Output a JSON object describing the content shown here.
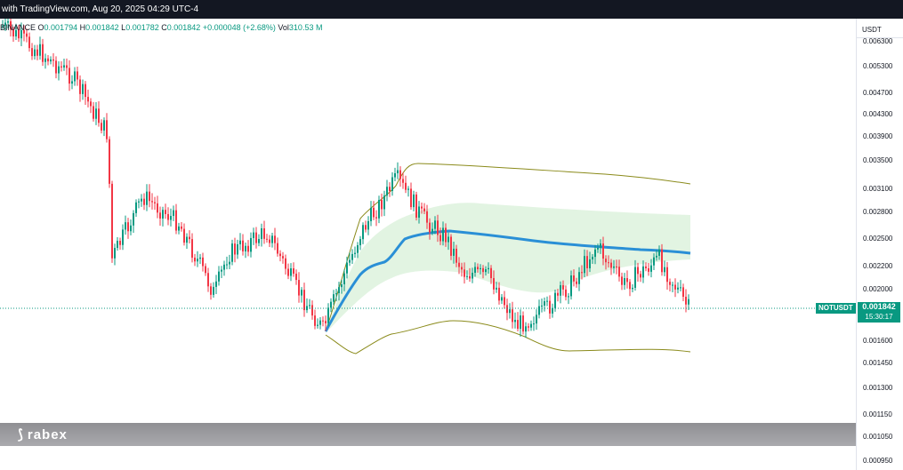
{
  "header": {
    "credit": "with TradingView.com, Aug 20, 2025 04:29 UTC-4"
  },
  "ohlc": {
    "exchange": "BINANCE",
    "open_label": "O",
    "open": "0.001794",
    "high_label": "H",
    "high": "0.001842",
    "low_label": "L",
    "low": "0.001782",
    "close_label": "C",
    "close": "0.001842",
    "change": "+0.000048 (+2.68%)",
    "vol_label": "Vol",
    "vol": "310.53 M"
  },
  "price_axis": {
    "unit": "USDT",
    "ticks": [
      "0.006300",
      "0.005300",
      "0.004700",
      "0.004300",
      "0.003900",
      "0.003500",
      "0.003100",
      "0.002800",
      "0.002500",
      "0.002200",
      "0.002000",
      "0.001600",
      "0.001450",
      "0.001300",
      "0.001150",
      "0.001050",
      "0.000950"
    ]
  },
  "current_price": {
    "symbol": "NOTUSDT",
    "price": "0.001842",
    "countdown": "15:30:17"
  },
  "footer": {
    "logo": "rabex"
  },
  "colors": {
    "up": "#089981",
    "down": "#f23645",
    "ma_line": "#2a8fd6",
    "band": "#8a8a1a",
    "band_fill": "#d8f0d8"
  },
  "chart_data": {
    "type": "candlestick",
    "title": "",
    "y_scale": "log",
    "ylim": [
      0.00095,
      0.0064
    ],
    "current_price": 0.001842
  }
}
